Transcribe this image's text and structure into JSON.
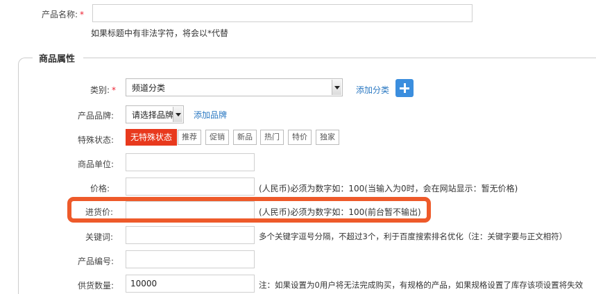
{
  "product_name": {
    "label": "产品名称:",
    "required_mark": "*",
    "value": "",
    "hint": "如果标题中有非法字符，将会以*代替"
  },
  "section": {
    "legend": "商品属性"
  },
  "category": {
    "label": "类别:",
    "required_mark": "*",
    "selected": "频道分类",
    "add_link": "添加分类"
  },
  "brand": {
    "label": "产品品牌:",
    "selected": "请选择品牌",
    "add_link": "添加品牌"
  },
  "status": {
    "label": "特殊状态:",
    "options": [
      "无特殊状态",
      "推荐",
      "促销",
      "新品",
      "热门",
      "特价",
      "独家"
    ],
    "active_index": 0
  },
  "unit": {
    "label": "商品单位:",
    "value": ""
  },
  "price": {
    "label": "价格:",
    "value": "",
    "hint": "(人民币)必须为数字如：100(当输入为0时，会在网站显示：暂无价格)"
  },
  "cost_price": {
    "label": "进货价:",
    "value": "",
    "hint": "(人民币)必须为数字如：100(前台暂不输出)"
  },
  "keywords": {
    "label": "关键词:",
    "value": "",
    "hint": "多个关键字逗号分隔，不超过3个，利于百度搜索排名优化（注：关键字要与正文相符）"
  },
  "product_code": {
    "label": "产品编号:",
    "value": ""
  },
  "supply_qty": {
    "label": "供货数量:",
    "value": "10000",
    "hint": "注：如果设置为0用户将无法完成购买，有规格的产品，如果规格设置了库存该项设置将失效"
  },
  "colors": {
    "accent": "#e8391d",
    "link": "#2a78c2",
    "highlight": "#ee5a2a",
    "plus_button": "#3b8ede"
  }
}
